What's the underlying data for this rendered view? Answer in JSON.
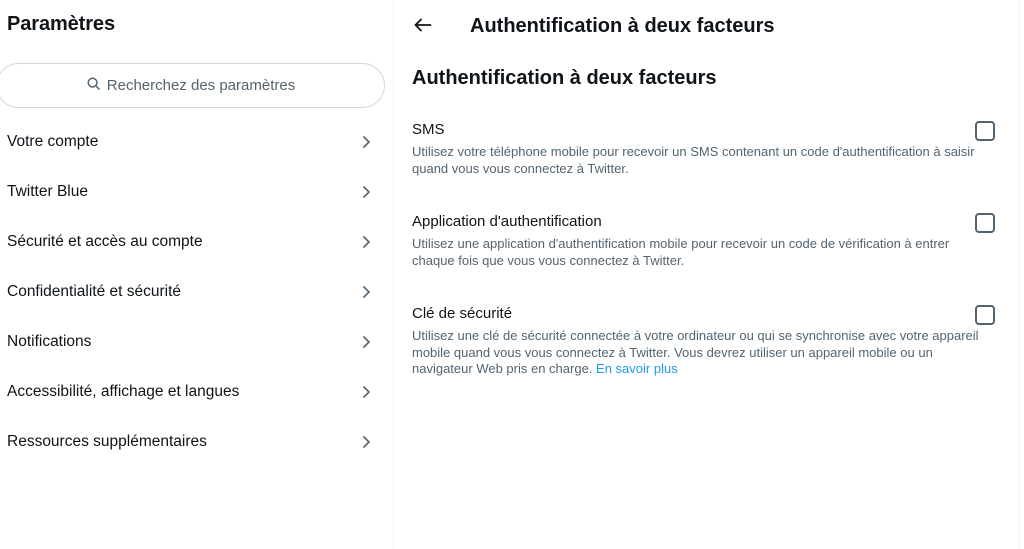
{
  "settings_panel": {
    "title": "Paramètres",
    "search": {
      "placeholder": "Recherchez des paramètres",
      "icon": "search-icon"
    },
    "menu_items": [
      {
        "label": "Votre compte",
        "icon": "chevron-right-icon"
      },
      {
        "label": "Twitter Blue",
        "icon": "chevron-right-icon"
      },
      {
        "label": "Sécurité et accès au compte",
        "icon": "chevron-right-icon"
      },
      {
        "label": "Confidentialité et sécurité",
        "icon": "chevron-right-icon"
      },
      {
        "label": "Notifications",
        "icon": "chevron-right-icon"
      },
      {
        "label": "Accessibilité, affichage et langues",
        "icon": "chevron-right-icon"
      },
      {
        "label": "Ressources supplémentaires",
        "icon": "chevron-right-icon"
      }
    ]
  },
  "detail_panel": {
    "back_icon": "arrow-left-icon",
    "header_title": "Authentification à deux facteurs",
    "section_title": "Authentification à deux facteurs",
    "options": [
      {
        "label": "SMS",
        "description": "Utilisez votre téléphone mobile pour recevoir un SMS contenant un code d'authentification à saisir quand vous vous connectez à Twitter.",
        "checked": false
      },
      {
        "label": "Application d'authentification",
        "description": "Utilisez une application d'authentification mobile pour recevoir un code de vérification à entrer chaque fois que vous vous connectez à Twitter.",
        "checked": false
      },
      {
        "label": "Clé de sécurité",
        "description": "Utilisez une clé de sécurité connectée à votre ordinateur ou qui se synchronise avec votre appareil mobile quand vous vous connectez à Twitter. Vous devrez utiliser un appareil mobile ou un navigateur Web pris en charge.",
        "link_text": "En savoir plus",
        "checked": false
      }
    ]
  },
  "colors": {
    "text_primary": "#0f1419",
    "text_secondary": "#536471",
    "link": "#1d9bf0",
    "border": "#cfd9de",
    "divider": "#eff3f4"
  }
}
